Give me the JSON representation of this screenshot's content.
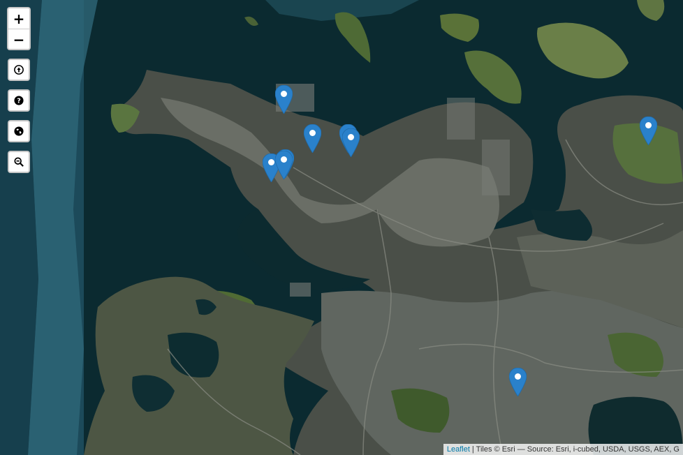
{
  "map": {
    "zoom_in_label": "+",
    "zoom_out_label": "−",
    "controls": [
      {
        "icon": "arrow-up-circle-icon"
      },
      {
        "icon": "question-circle-icon"
      },
      {
        "icon": "globe-icon"
      },
      {
        "icon": "zoom-out-magnifier-icon"
      }
    ],
    "markers_count": 9,
    "marker_color": "#2a81cb"
  },
  "attribution": {
    "link_text": "Leaflet",
    "separator": " | ",
    "tiles_text": "Tiles © Esri — Source: Esri, i-cubed, USDA, USGS, AEX, G"
  }
}
